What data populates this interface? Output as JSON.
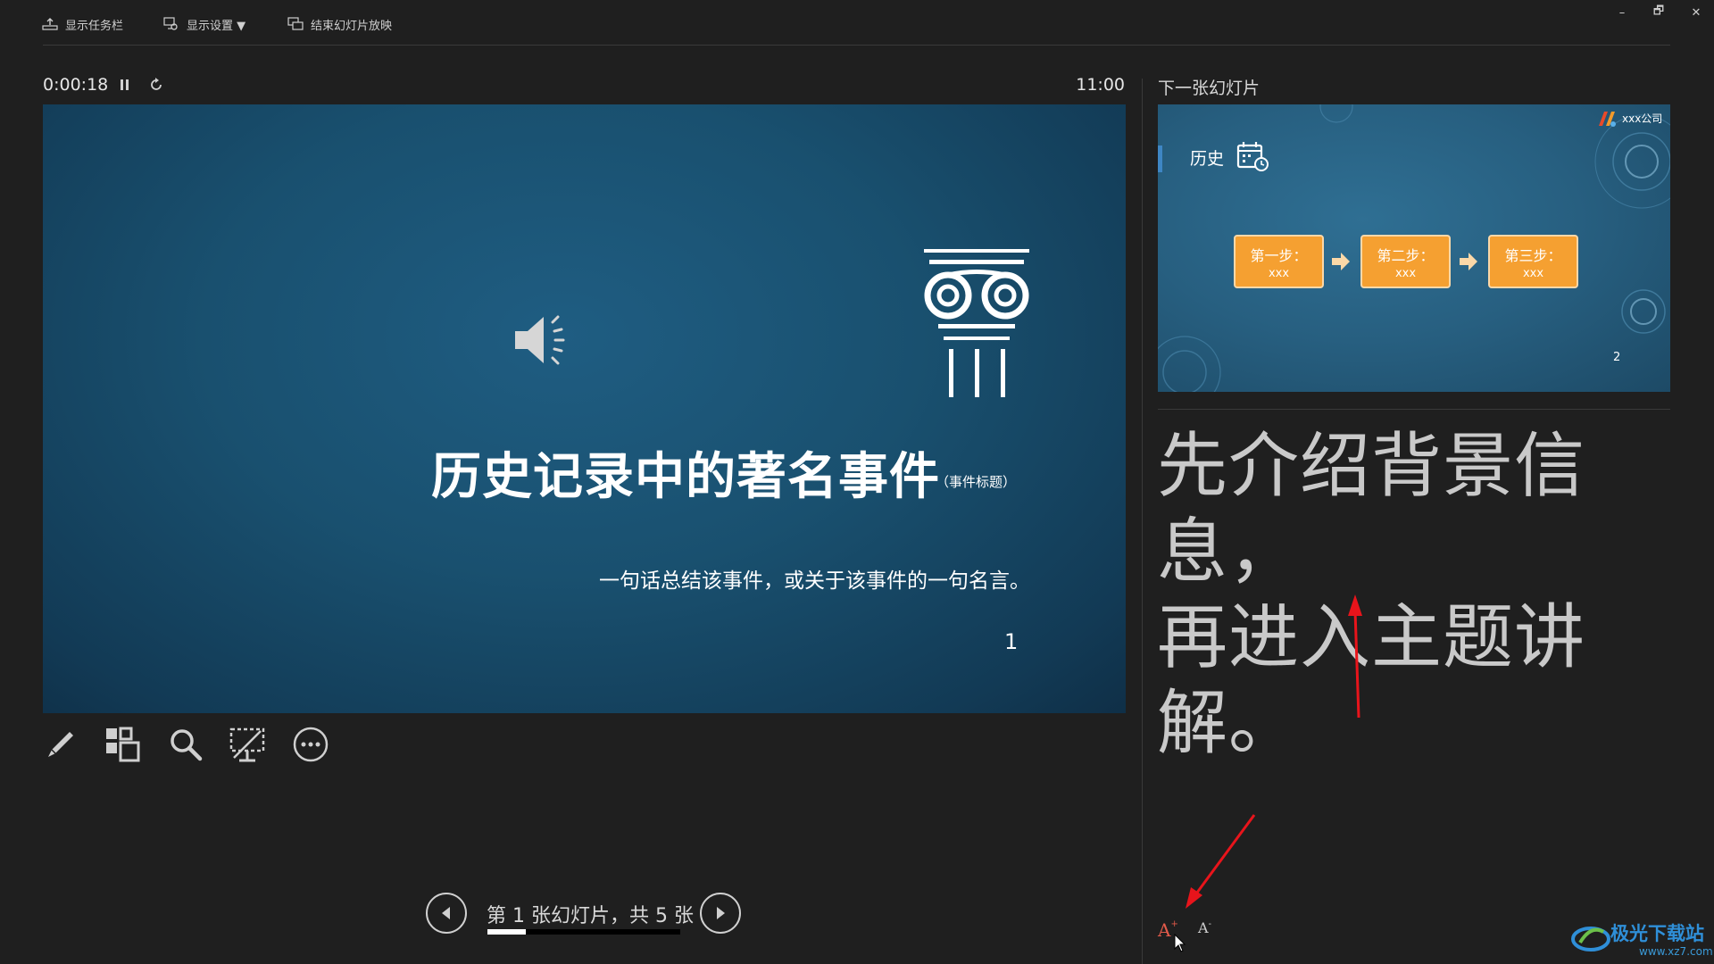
{
  "toolbar": {
    "show_taskbar": "显示任务栏",
    "display_settings": "显示设置 ▼",
    "end_show": "结束幻灯片放映"
  },
  "window_controls": {
    "minimize": "–",
    "restore": "🗗",
    "close": "✕"
  },
  "timer": {
    "elapsed": "0:00:18",
    "clock": "11:00"
  },
  "current_slide": {
    "title": "历史记录中的著名事件",
    "title_note": "（事件标题）",
    "subtitle": "一句话总结该事件，或关于该事件的一句名言。",
    "number": "1"
  },
  "tools": [
    "pen-icon",
    "slides-grid-icon",
    "zoom-icon",
    "screen-blackout-icon",
    "more-options-icon"
  ],
  "next_slide": {
    "label": "下一张幻灯片",
    "title": "历史",
    "company": "xxx公司",
    "steps": [
      {
        "line1": "第一步：",
        "line2": "xxx"
      },
      {
        "line1": "第二步：",
        "line2": "xxx"
      },
      {
        "line1": "第三步：",
        "line2": "xxx"
      }
    ],
    "number": "2"
  },
  "notes": {
    "line1": "先介绍背景信息，",
    "line2": "再进入主题讲解。"
  },
  "navigation": {
    "slide_counter": "第 1 张幻灯片，共 5 张",
    "progress_fraction": 0.2
  },
  "font_controls": {
    "increase": "A",
    "decrease": "A"
  },
  "watermark": {
    "brand": "极光下载站",
    "url": "www.xz7.com"
  },
  "colors": {
    "annotation": "#e8141b",
    "step_fill": "#f5a031",
    "slide_bg": "#19506f"
  }
}
